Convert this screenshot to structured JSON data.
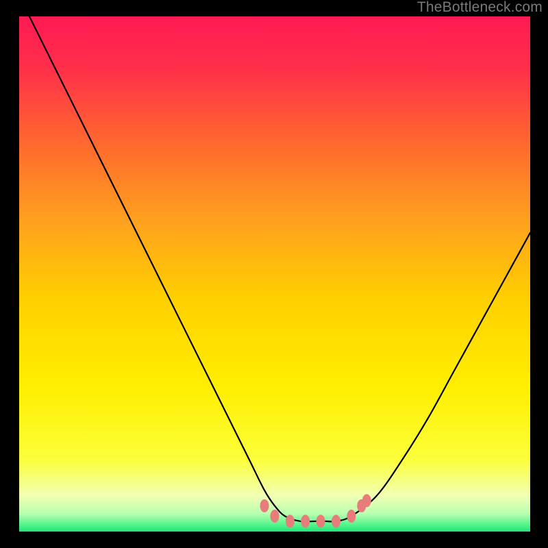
{
  "watermark": "TheBottleneck.com",
  "palette": {
    "page_bg": "#000000",
    "watermark_color": "#7a7a7a",
    "curve_color": "#000000",
    "marker_fill": "#e77d7a",
    "marker_stroke": "#e77d7a",
    "gradient_top": "#ff1a52",
    "gradient_mid1": "#ff8a2a",
    "gradient_mid2": "#ffe400",
    "gradient_low": "#f5ffb0",
    "gradient_bottom": "#23f07a"
  },
  "chart_data": {
    "type": "line",
    "title": "",
    "xlabel": "",
    "ylabel": "",
    "xlim": [
      0,
      100
    ],
    "ylim": [
      0,
      100
    ],
    "grid": false,
    "legend": false,
    "annotations": [
      "TheBottleneck.com"
    ],
    "series": [
      {
        "name": "bottleneck-curve",
        "x": [
          2,
          5,
          10,
          15,
          20,
          25,
          30,
          35,
          40,
          45,
          48,
          50,
          52,
          55,
          58,
          60,
          62,
          65,
          70,
          75,
          80,
          85,
          90,
          95,
          100
        ],
        "y": [
          100,
          94,
          84,
          74,
          64,
          54,
          44,
          34,
          24,
          14,
          8,
          5,
          3,
          2,
          2,
          2,
          2,
          3,
          7,
          14,
          22,
          31,
          40,
          49,
          58
        ]
      }
    ],
    "markers": [
      {
        "x": 48,
        "y": 5
      },
      {
        "x": 50,
        "y": 3
      },
      {
        "x": 53,
        "y": 2
      },
      {
        "x": 56,
        "y": 2
      },
      {
        "x": 59,
        "y": 2
      },
      {
        "x": 62,
        "y": 2
      },
      {
        "x": 65,
        "y": 3
      },
      {
        "x": 67,
        "y": 5
      },
      {
        "x": 68,
        "y": 6
      }
    ],
    "marker_rx": 6.5,
    "marker_ry": 9.5
  }
}
